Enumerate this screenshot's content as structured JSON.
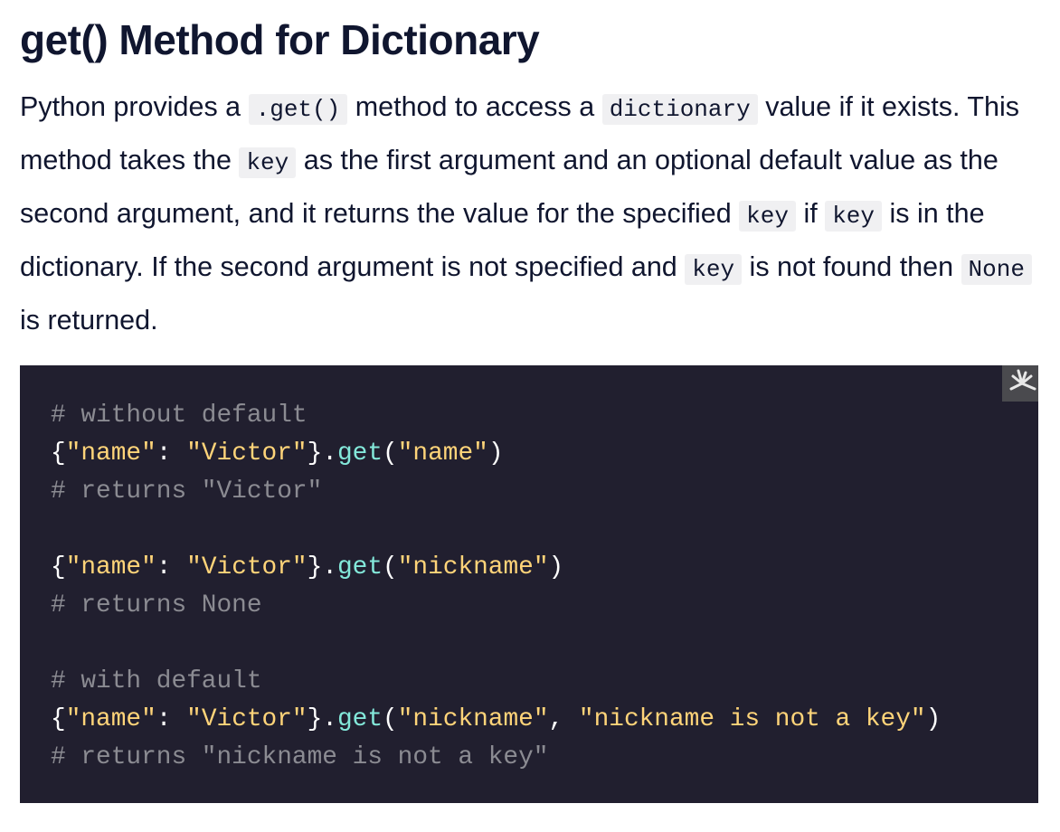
{
  "title": "get() Method for Dictionary",
  "paragraph": [
    {
      "type": "text",
      "value": "Python provides a "
    },
    {
      "type": "code",
      "value": ".get()"
    },
    {
      "type": "text",
      "value": " method to access a "
    },
    {
      "type": "code",
      "value": "dictionary"
    },
    {
      "type": "text",
      "value": " value if it exists. This method takes the "
    },
    {
      "type": "code",
      "value": "key"
    },
    {
      "type": "text",
      "value": " as the first argument and an optional default value as the second argument, and it returns the value for the specified "
    },
    {
      "type": "code",
      "value": "key"
    },
    {
      "type": "text",
      "value": " if "
    },
    {
      "type": "code",
      "value": "key"
    },
    {
      "type": "text",
      "value": " is in the dictionary. If the second argument is not specified and "
    },
    {
      "type": "code",
      "value": "key"
    },
    {
      "type": "text",
      "value": " is not found then "
    },
    {
      "type": "code",
      "value": "None"
    },
    {
      "type": "text",
      "value": " is returned."
    }
  ],
  "code_icon": "expand-icon",
  "colors": {
    "background": "#211f2f",
    "string": "#ffd479",
    "method": "#83e8da",
    "comment": "#8b8b92"
  },
  "code_lines": [
    [
      {
        "c": "comment",
        "t": "# without default"
      }
    ],
    [
      {
        "c": "punct",
        "t": "{"
      },
      {
        "c": "string",
        "t": "\"name\""
      },
      {
        "c": "punct",
        "t": ": "
      },
      {
        "c": "string",
        "t": "\"Victor\""
      },
      {
        "c": "punct",
        "t": "}."
      },
      {
        "c": "method",
        "t": "get"
      },
      {
        "c": "punct",
        "t": "("
      },
      {
        "c": "string",
        "t": "\"name\""
      },
      {
        "c": "punct",
        "t": ")"
      }
    ],
    [
      {
        "c": "comment",
        "t": "# returns \"Victor\""
      }
    ],
    [],
    [
      {
        "c": "punct",
        "t": "{"
      },
      {
        "c": "string",
        "t": "\"name\""
      },
      {
        "c": "punct",
        "t": ": "
      },
      {
        "c": "string",
        "t": "\"Victor\""
      },
      {
        "c": "punct",
        "t": "}."
      },
      {
        "c": "method",
        "t": "get"
      },
      {
        "c": "punct",
        "t": "("
      },
      {
        "c": "string",
        "t": "\"nickname\""
      },
      {
        "c": "punct",
        "t": ")"
      }
    ],
    [
      {
        "c": "comment",
        "t": "# returns None"
      }
    ],
    [],
    [
      {
        "c": "comment",
        "t": "# with default"
      }
    ],
    [
      {
        "c": "punct",
        "t": "{"
      },
      {
        "c": "string",
        "t": "\"name\""
      },
      {
        "c": "punct",
        "t": ": "
      },
      {
        "c": "string",
        "t": "\"Victor\""
      },
      {
        "c": "punct",
        "t": "}."
      },
      {
        "c": "method",
        "t": "get"
      },
      {
        "c": "punct",
        "t": "("
      },
      {
        "c": "string",
        "t": "\"nickname\""
      },
      {
        "c": "punct",
        "t": ", "
      },
      {
        "c": "string",
        "t": "\"nickname is not a key\""
      },
      {
        "c": "punct",
        "t": ")"
      }
    ],
    [
      {
        "c": "comment",
        "t": "# returns \"nickname is not a key\""
      }
    ]
  ]
}
